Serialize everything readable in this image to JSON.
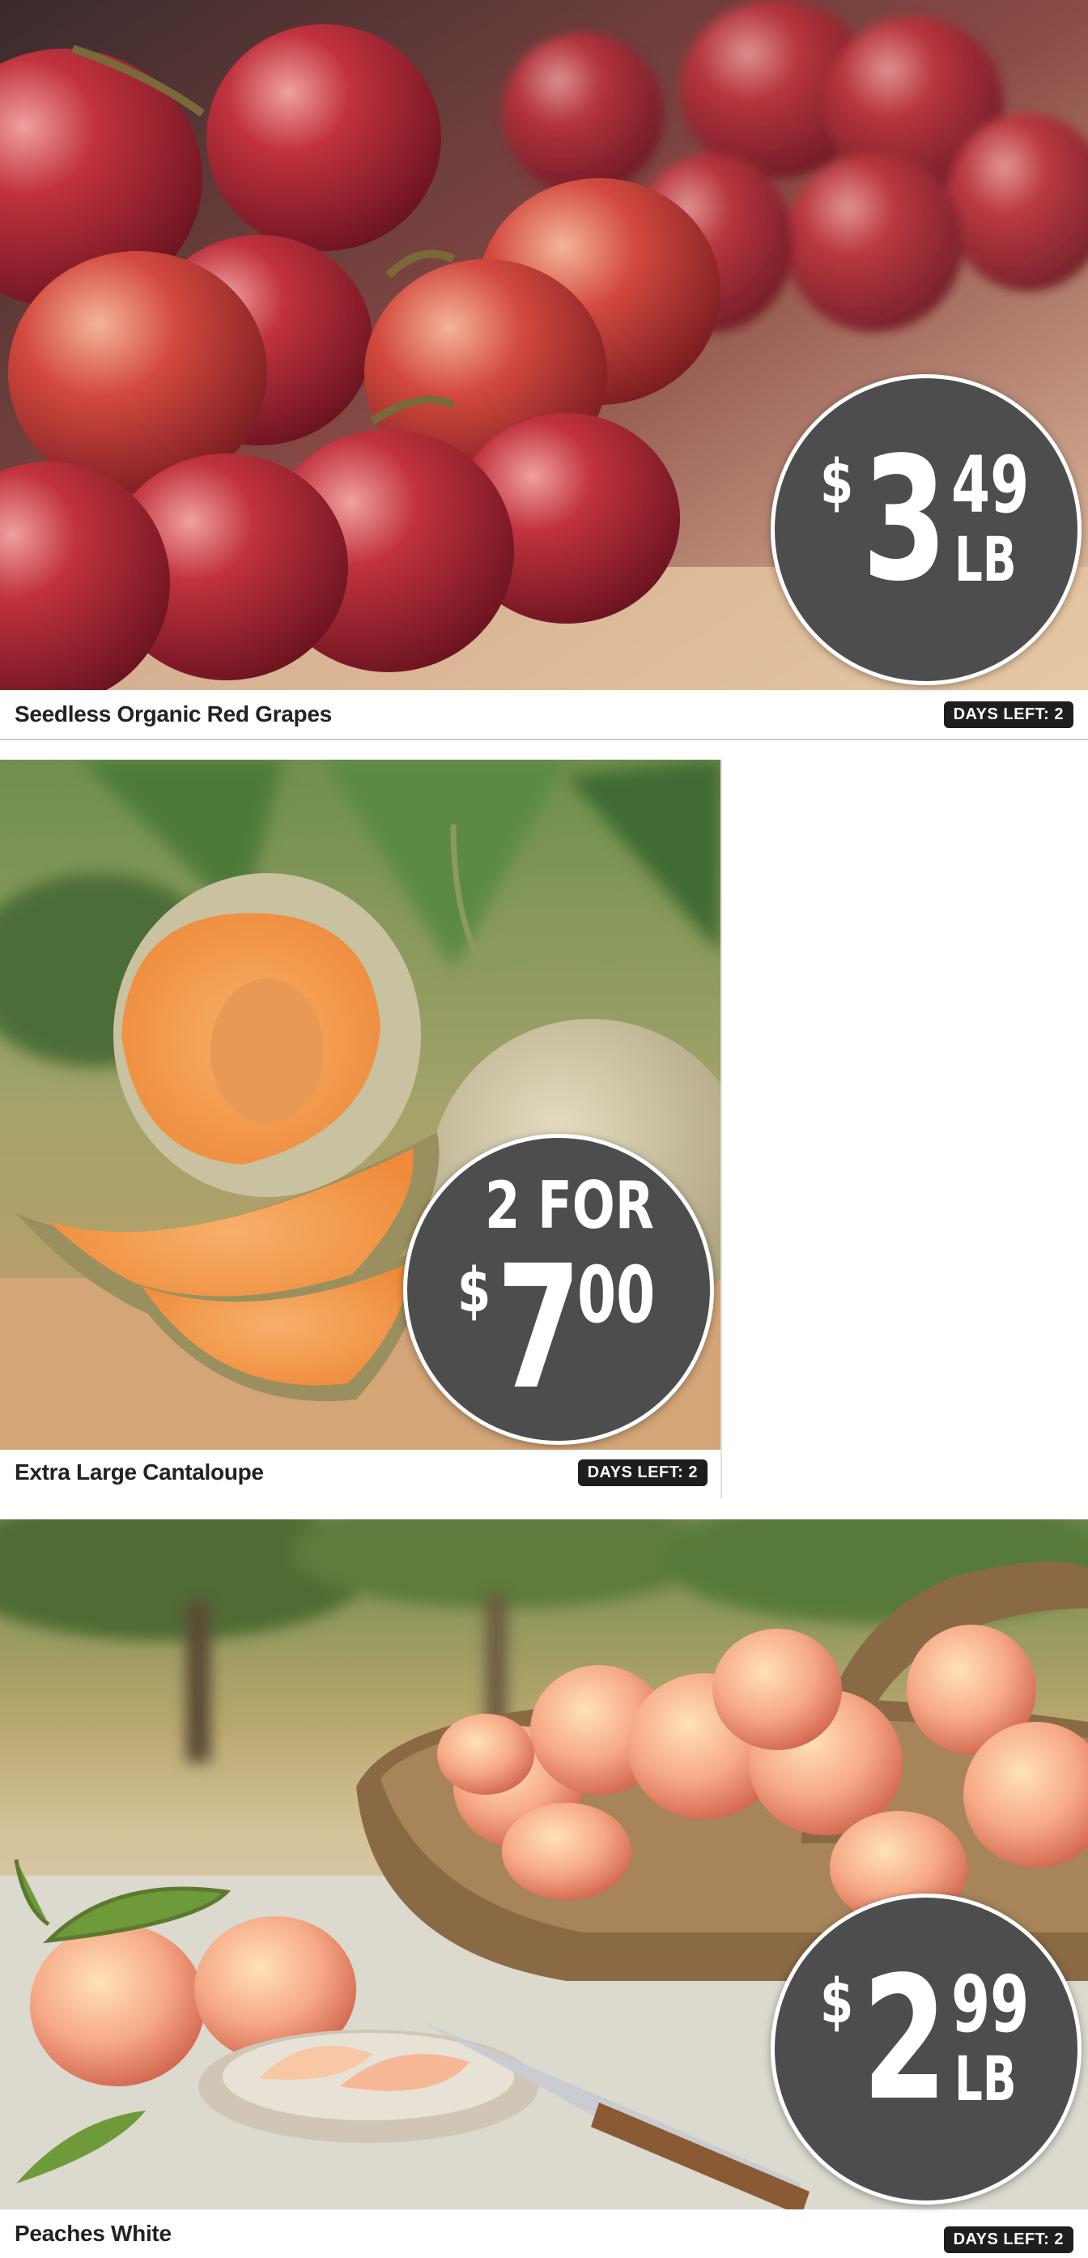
{
  "products": [
    {
      "name": "Seedless Organic Red Grapes",
      "days_left": "DAYS LEFT: 2",
      "price": {
        "symbol": "$",
        "dollars": "3",
        "cents": "49",
        "unit": "LB"
      },
      "image_icon": "grapes-image"
    },
    {
      "name": "Extra Large Cantaloupe",
      "days_left": "DAYS LEFT: 2",
      "price": {
        "deal": "2 FOR",
        "symbol": "$",
        "dollars": "7",
        "cents": "00"
      },
      "image_icon": "cantaloupe-image"
    },
    {
      "name": "Peaches White",
      "days_left": "DAYS LEFT: 2",
      "price": {
        "symbol": "$",
        "dollars": "2",
        "cents": "99",
        "unit": "LB"
      },
      "image_icon": "peaches-image"
    }
  ],
  "colors": {
    "price_circle": "#4d4d4d",
    "badge_bg": "#1e1e1e",
    "title_text": "#222222"
  }
}
